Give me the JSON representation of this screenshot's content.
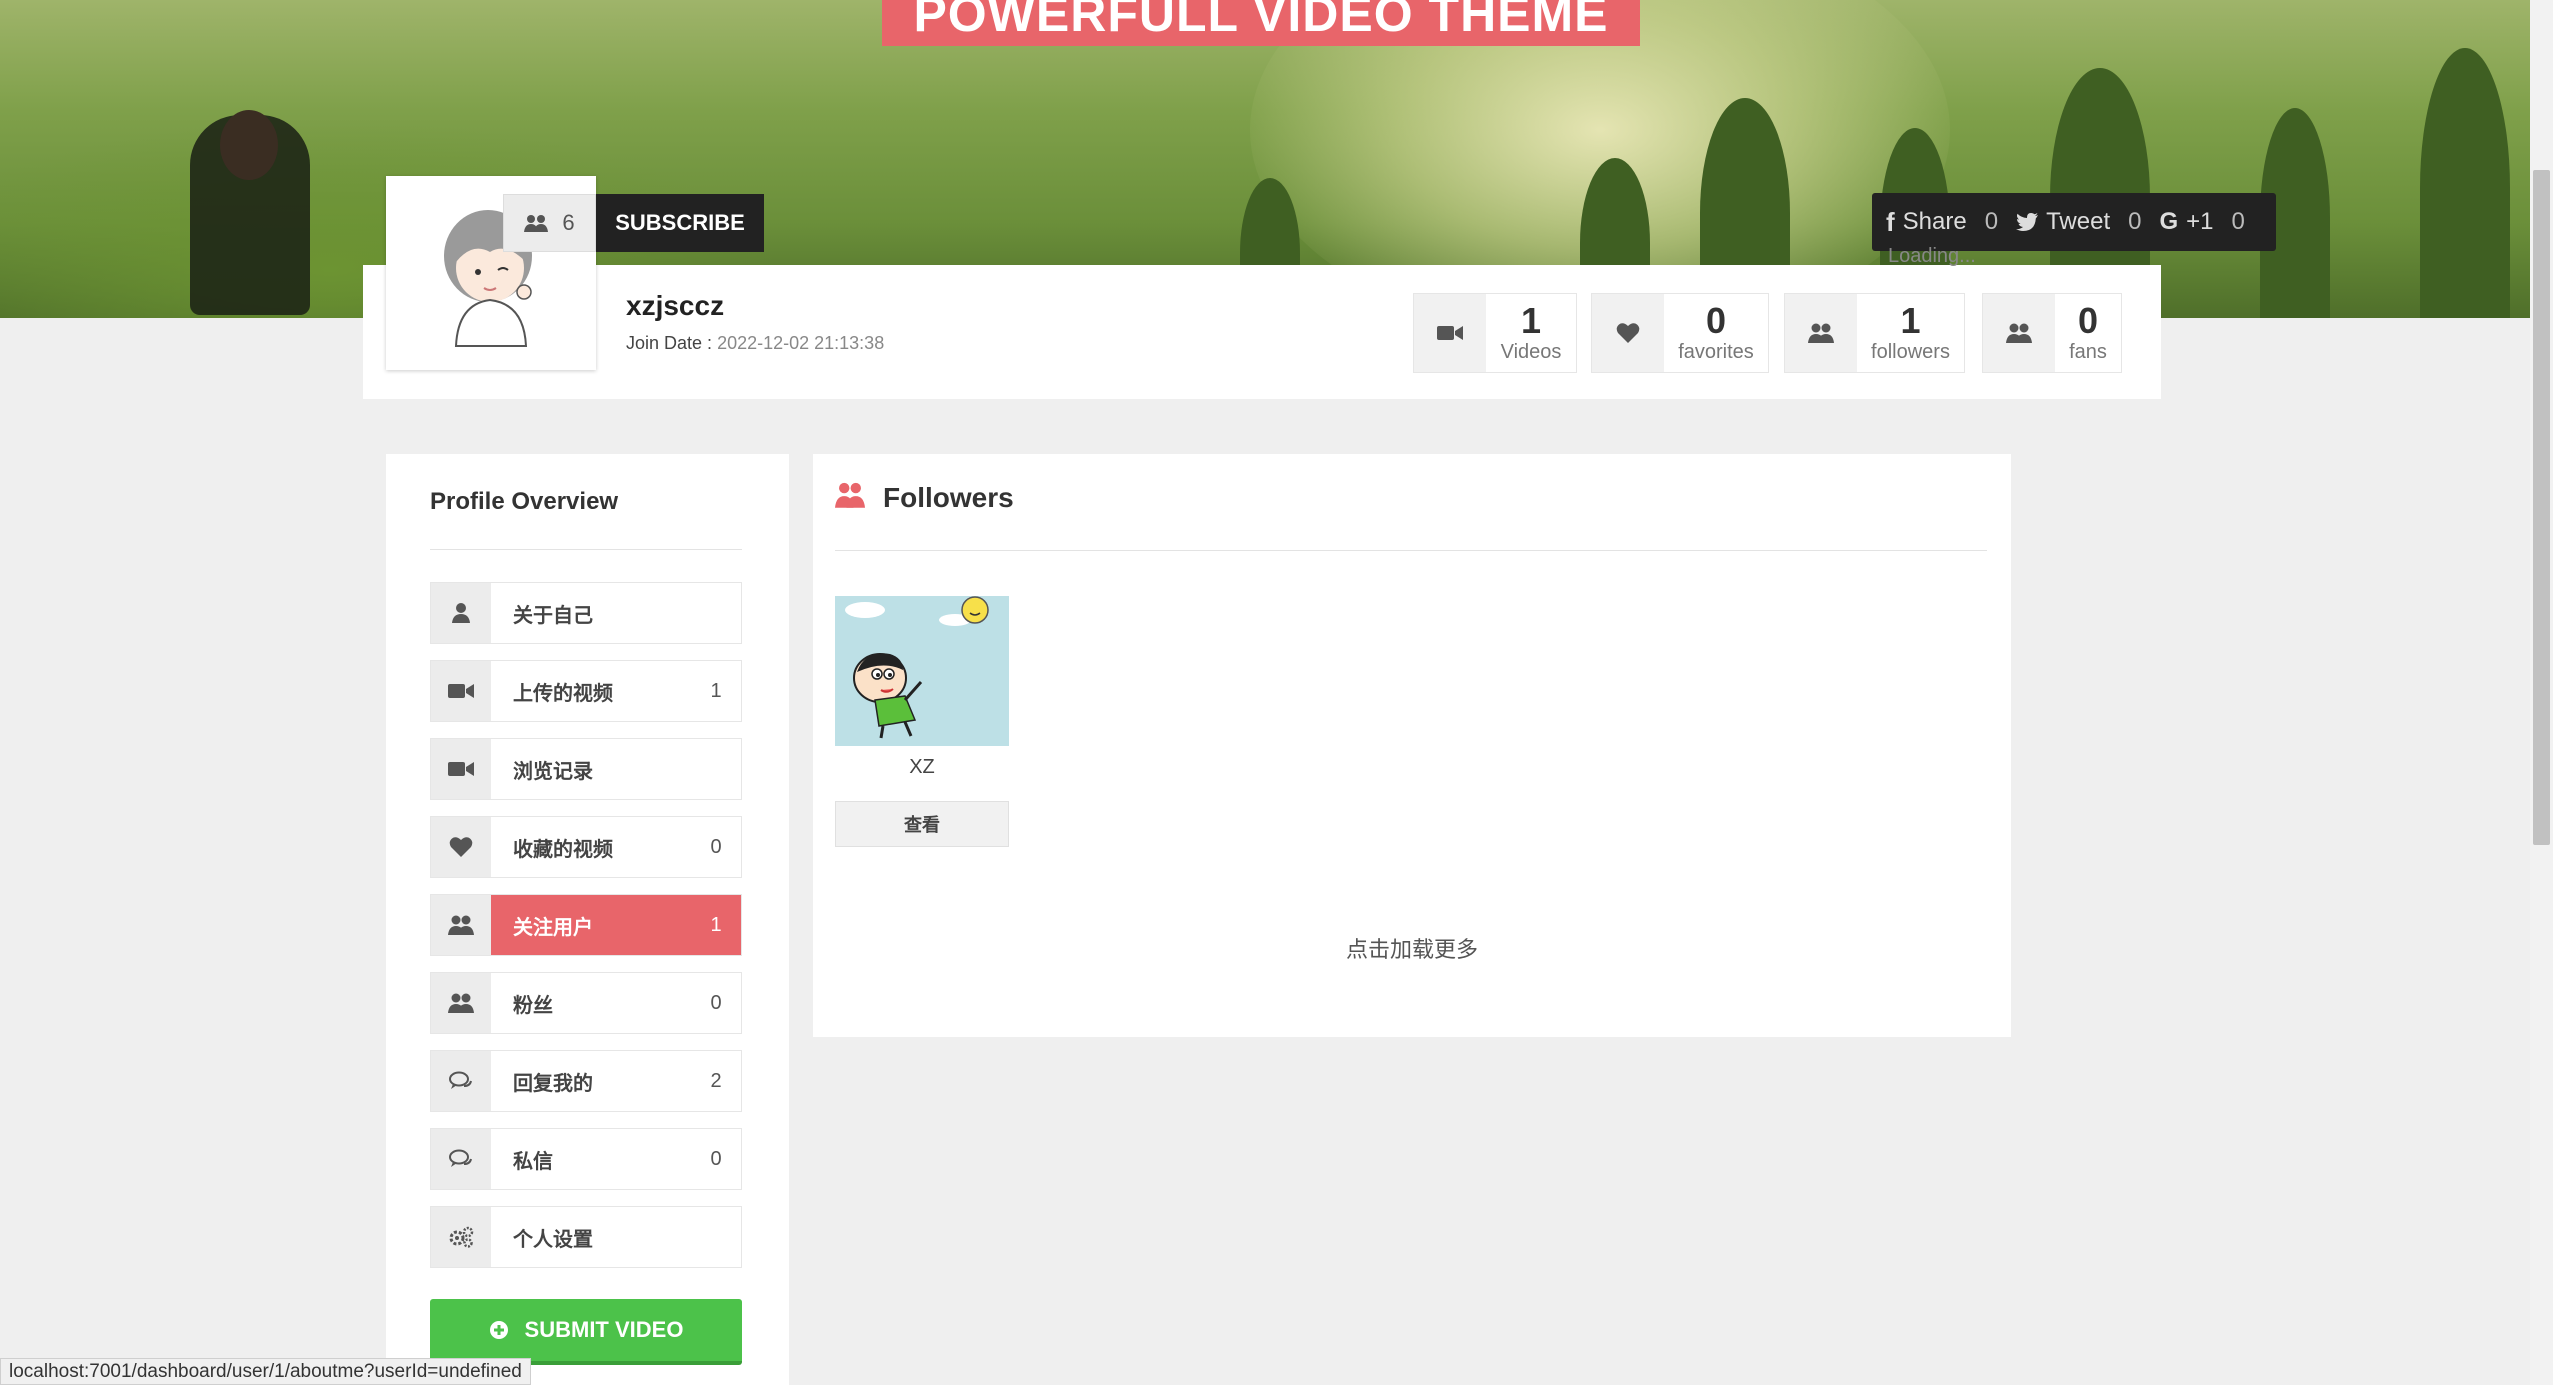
{
  "hero": {
    "theme_title": "POWERFULL VIDEO THEME"
  },
  "profile": {
    "subscriber_count": "6",
    "subscribe_label": "SUBSCRIBE",
    "username": "xzjsccz",
    "join_date_label": "Join Date :",
    "join_date": "2022-12-02 21:13:38"
  },
  "share": {
    "facebook_label": "Share",
    "facebook_count": "0",
    "twitter_label": "Tweet",
    "twitter_count": "0",
    "gplus_label": "+1",
    "gplus_count": "0",
    "loading_text": "Loading..."
  },
  "stats": [
    {
      "icon": "video-camera-icon",
      "value": "1",
      "label": "Videos"
    },
    {
      "icon": "heart-icon",
      "value": "0",
      "label": "favorites"
    },
    {
      "icon": "users-icon",
      "value": "1",
      "label": "followers"
    },
    {
      "icon": "users-icon",
      "value": "0",
      "label": "fans"
    }
  ],
  "sidebar": {
    "title": "Profile Overview",
    "items": [
      {
        "icon": "user-icon",
        "label": "关于自己",
        "count": ""
      },
      {
        "icon": "video-camera-icon",
        "label": "上传的视频",
        "count": "1"
      },
      {
        "icon": "video-camera-icon",
        "label": "浏览记录",
        "count": ""
      },
      {
        "icon": "heart-icon",
        "label": "收藏的视频",
        "count": "0"
      },
      {
        "icon": "users-icon",
        "label": "关注用户",
        "count": "1",
        "active": true
      },
      {
        "icon": "users-icon",
        "label": "粉丝",
        "count": "0"
      },
      {
        "icon": "comments-icon",
        "label": "回复我的",
        "count": "2"
      },
      {
        "icon": "comments-icon",
        "label": "私信",
        "count": "0"
      },
      {
        "icon": "cogs-icon",
        "label": "个人设置",
        "count": ""
      }
    ],
    "submit_label": "SUBMIT VIDEO"
  },
  "main": {
    "title": "Followers",
    "followers": [
      {
        "name": "XZ",
        "view_label": "查看"
      }
    ],
    "load_more": "点击加载更多"
  },
  "status_bar": {
    "url": "localhost:7001/dashboard/user/1/aboutme?userId=undefined"
  },
  "colors": {
    "accent": "#e8656a",
    "submit": "#4cc24a",
    "dark": "#222222"
  }
}
